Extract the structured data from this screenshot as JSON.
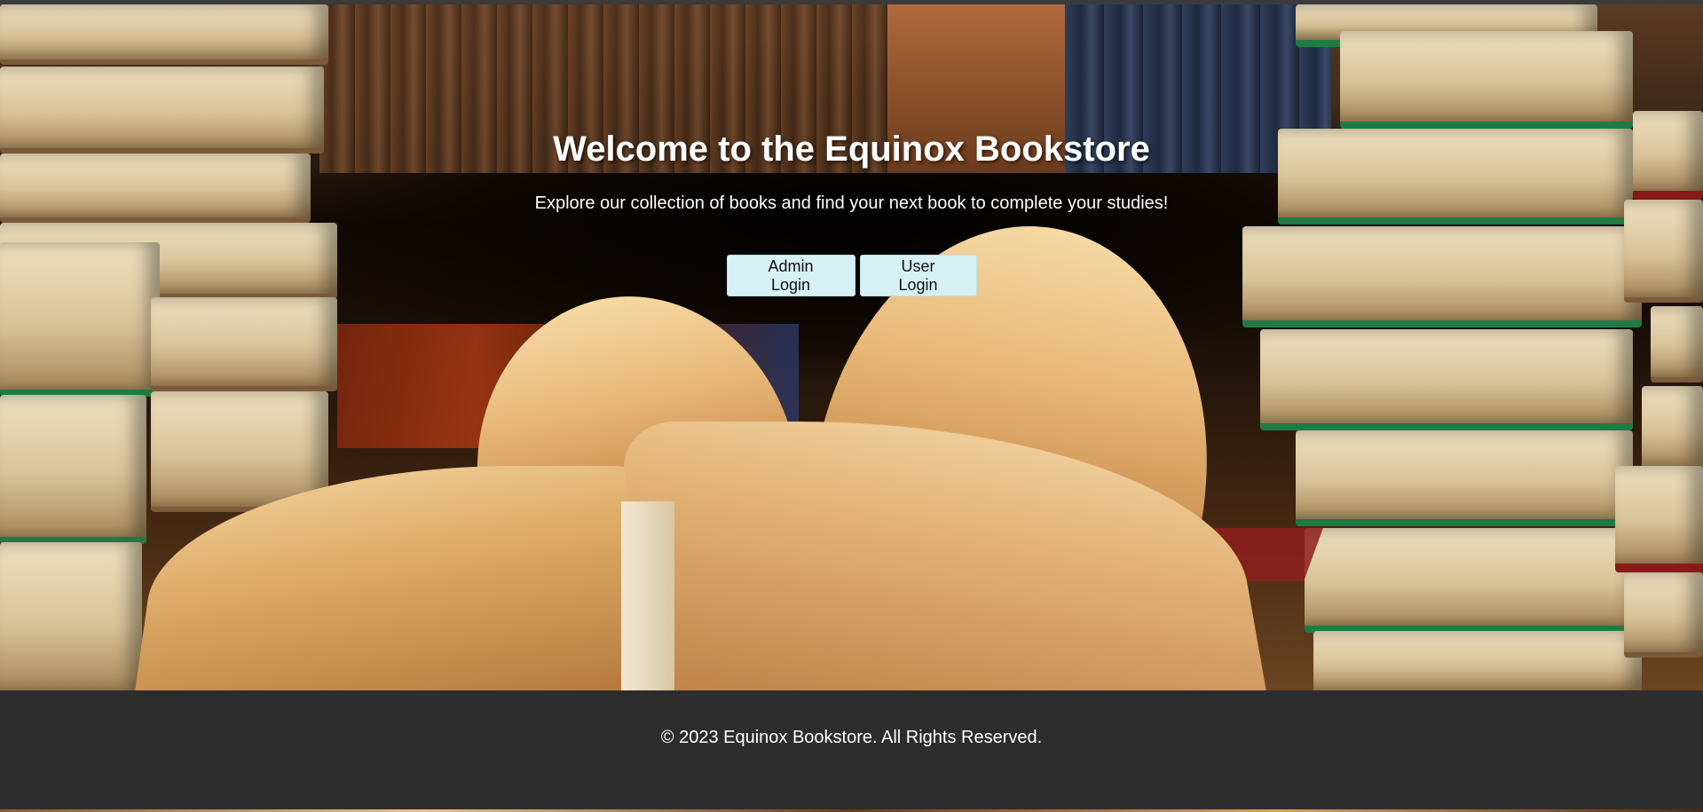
{
  "hero": {
    "title": "Welcome to the Equinox Bookstore",
    "subtitle": "Explore our collection of books and find your next book to complete your studies!",
    "buttons": {
      "admin_login": "Admin Login",
      "user_login": "User Login"
    },
    "background_image": "photo of open books and stacked books"
  },
  "footer": {
    "copyright": "© 2023 Equinox Bookstore. All Rights Reserved."
  },
  "colors": {
    "button_bg": "#d6f1f4",
    "footer_bg": "#2d2d2d",
    "text": "#ffffff"
  }
}
